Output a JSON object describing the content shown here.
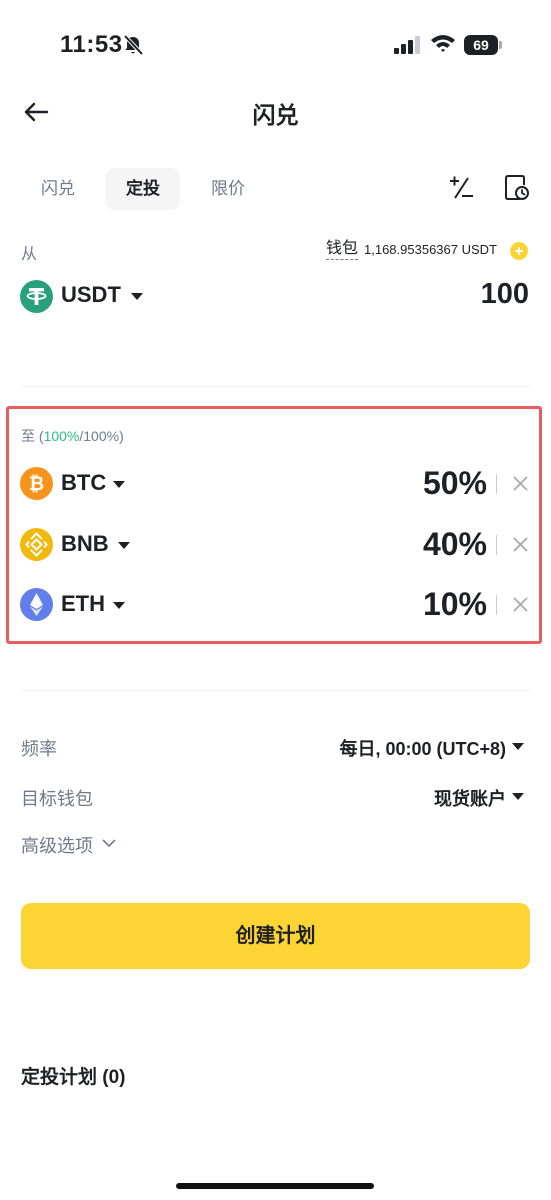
{
  "status_bar": {
    "time": "11:53",
    "battery": "69"
  },
  "header": {
    "title": "闪兑"
  },
  "tabs": [
    {
      "label": "闪兑",
      "active": false
    },
    {
      "label": "定投",
      "active": true
    },
    {
      "label": "限价",
      "active": false
    }
  ],
  "from": {
    "label": "从",
    "wallet_label": "钱包",
    "balance": "1,168.95356367 USDT",
    "coin": "USDT",
    "amount": "100"
  },
  "to": {
    "label_prefix": "至 (",
    "allocated": "100%",
    "label_suffix": "/100%)",
    "items": [
      {
        "coin": "BTC",
        "percent": "50%",
        "icon_color": "#f7931a"
      },
      {
        "coin": "BNB",
        "percent": "40%",
        "icon_color": "#f0b90b"
      },
      {
        "coin": "ETH",
        "percent": "10%",
        "icon_color": "#627eea"
      }
    ]
  },
  "settings": {
    "frequency_label": "频率",
    "frequency_value": "每日, 00:00 (UTC+8)",
    "wallet_label": "目标钱包",
    "wallet_value": "现货账户",
    "advanced_label": "高级选项"
  },
  "cta": {
    "label": "创建计划"
  },
  "plans": {
    "title": "定投计划 (0)"
  },
  "colors": {
    "accent_yellow": "#fcd535",
    "highlight_red": "#e85e60",
    "positive_green": "#2ebd85",
    "usdt_green": "#26a17b"
  }
}
